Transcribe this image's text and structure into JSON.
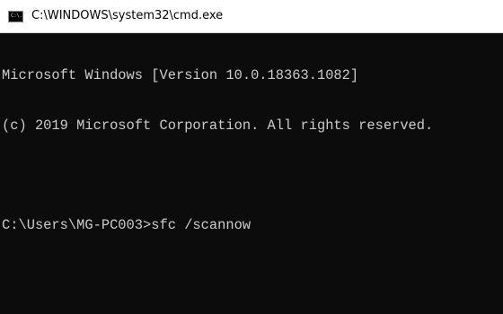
{
  "window": {
    "title": "C:\\WINDOWS\\system32\\cmd.exe",
    "icon": "cmd-icon",
    "icon_text": "C:\\."
  },
  "console": {
    "lines": [
      "Microsoft Windows [Version 10.0.18363.1082]",
      "(c) 2019 Microsoft Corporation. All rights reserved.",
      ""
    ],
    "prompt": "C:\\Users\\MG-PC003>",
    "command": "sfc /scannow"
  },
  "colors": {
    "background": "#0c0c0c",
    "foreground": "#cccccc",
    "titlebar": "#ffffff"
  }
}
